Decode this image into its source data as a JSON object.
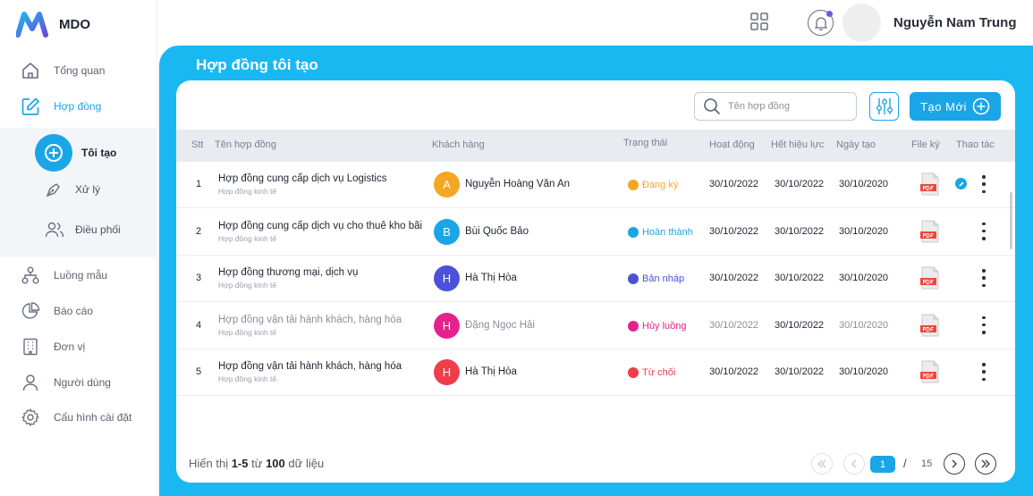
{
  "app": {
    "brand": "MDO"
  },
  "header": {
    "user_name": "Nguyễn Nam Trung"
  },
  "sidebar": {
    "items": [
      {
        "label": "Tổng quan",
        "icon": "home-icon"
      },
      {
        "label": "Hợp đồng",
        "icon": "edit-document-icon",
        "active": true
      },
      {
        "label": "Luồng mẫu",
        "icon": "flow-icon"
      },
      {
        "label": "Báo cáo",
        "icon": "pie-chart-icon"
      },
      {
        "label": "Đơn vị",
        "icon": "building-icon"
      },
      {
        "label": "Người dùng",
        "icon": "user-icon"
      },
      {
        "label": "Cấu hình cài đặt",
        "icon": "gear-icon"
      }
    ],
    "sub_items": [
      {
        "label": "Tôi tạo",
        "icon": "plus-circle-icon",
        "active": true
      },
      {
        "label": "Xử lý",
        "icon": "pen-nib-icon"
      },
      {
        "label": "Điều phối",
        "icon": "users-icon"
      }
    ]
  },
  "main": {
    "title": "Hợp đồng tôi tạo",
    "search_placeholder": "Tên hợp đồng",
    "create_label": "Tạo Mới",
    "columns": [
      "Stt",
      "Tên hợp đồng",
      "Khách hàng",
      "Trạng thái",
      "Hoạt động",
      "Hết hiệu lực",
      "Ngày tạo",
      "File ký",
      "Thao tác"
    ],
    "rows": [
      {
        "stt": "1",
        "name": "Hợp đồng cung cấp dịch vụ Logistics",
        "type": "Hợp đồng kinh tế",
        "initial": "A",
        "avatar_color": "#f5a623",
        "customer": "Nguyễn Hoàng Văn An",
        "status": "Đang ký",
        "status_color": "#f5a623",
        "active_date": "30/10/2022",
        "expire_date": "30/10/2022",
        "created_date": "30/10/2020",
        "muted": false,
        "has_edit": true
      },
      {
        "stt": "2",
        "name": "Hợp đồng cung cấp dịch vụ cho thuê kho bãi",
        "type": "Hợp đồng kinh tế",
        "initial": "B",
        "avatar_color": "#1aa5e6",
        "customer": "Bùi Quốc Bảo",
        "status": "Hoàn thành",
        "status_color": "#1aa5e6",
        "active_date": "30/10/2022",
        "expire_date": "30/10/2022",
        "created_date": "30/10/2020",
        "muted": false,
        "has_edit": false
      },
      {
        "stt": "3",
        "name": "Hợp đồng thương mại, dịch vụ",
        "type": "Hợp đồng kinh tế",
        "initial": "H",
        "avatar_color": "#4b52d9",
        "customer": "Hà Thị Hòa",
        "status": "Bản nháp",
        "status_color": "#4b52d9",
        "active_date": "30/10/2022",
        "expire_date": "30/10/2022",
        "created_date": "30/10/2020",
        "muted": false,
        "has_edit": false
      },
      {
        "stt": "4",
        "name": "Hợp đồng vận tải hành khách, hàng hóa",
        "type": "Hợp đồng kinh tế",
        "initial": "H",
        "avatar_color": "#e5218b",
        "customer": "Đặng Ngọc Hải",
        "status": "Hủy luồng",
        "status_color": "#e5218b",
        "active_date": "30/10/2022",
        "expire_date": "30/10/2022",
        "created_date": "30/10/2020",
        "muted": true,
        "has_edit": false
      },
      {
        "stt": "5",
        "name": "Hợp đồng vận tải hành khách, hàng hóa",
        "type": "Hợp đồng kinh tế",
        "initial": "H",
        "avatar_color": "#ee3e4a",
        "customer": "Hà Thị Hòa",
        "status": "Từ chối",
        "status_color": "#ee3e4a",
        "active_date": "30/10/2022",
        "expire_date": "30/10/2022",
        "created_date": "30/10/2020",
        "muted": false,
        "has_edit": false
      }
    ],
    "footer": {
      "prefix": "Hiển thị",
      "range": "1-5",
      "from": "từ",
      "total": "100",
      "suffix": "dữ liệu"
    },
    "pagination": {
      "current": "1",
      "separator": "/",
      "total_pages": "15"
    }
  }
}
